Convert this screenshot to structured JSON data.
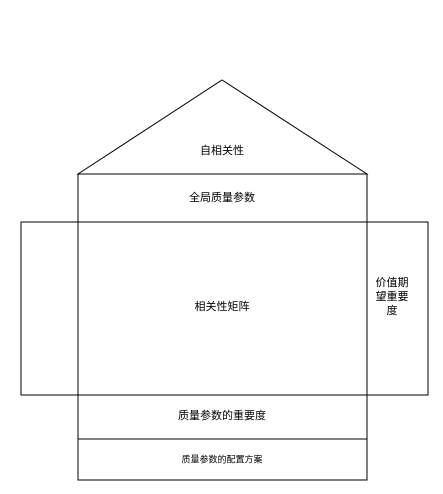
{
  "diagram": {
    "roof_label": "自相关性",
    "technical_params_label": "全局质量参数",
    "matrix_label": "相关性矩阵",
    "importance_label_lines": [
      "价值期",
      "望重要",
      "度"
    ],
    "param_importance_label": "质量参数的重要度",
    "configuration_label": "质量参数的配置方案"
  },
  "colors": {
    "stroke": "#000000",
    "fill": "#ffffff",
    "text": "#000000"
  }
}
